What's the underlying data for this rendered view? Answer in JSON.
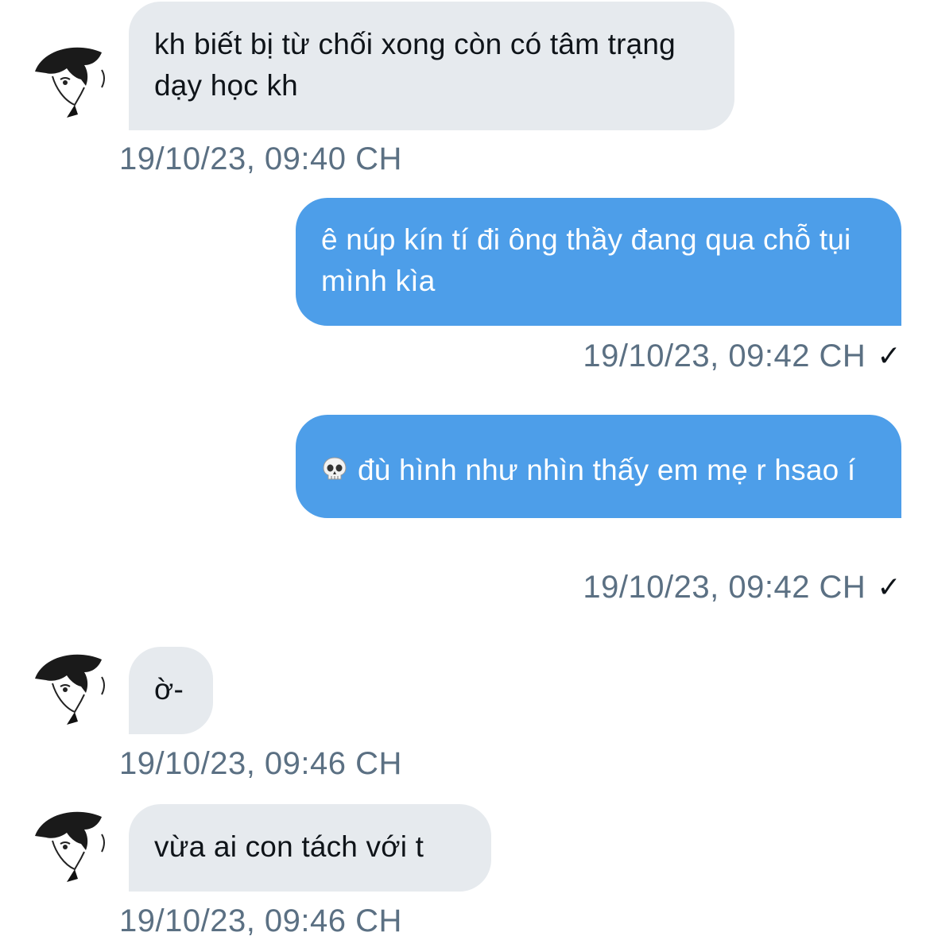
{
  "messages": [
    {
      "direction": "incoming",
      "text": "kh biết bị từ chối xong còn có tâm trạng dạy học kh",
      "timestamp": "19/10/23, 09:40 CH"
    },
    {
      "direction": "outgoing",
      "text": "ê núp kín tí đi ông thầy đang qua chỗ tụi mình kìa",
      "timestamp": "19/10/23, 09:42 CH",
      "status_icon": "check-icon",
      "status_glyph": "✓"
    },
    {
      "direction": "outgoing",
      "emoji_icon": "skull-emoji",
      "text": "đù hình như nhìn thấy em mẹ r hsao í",
      "timestamp": "19/10/23, 09:42 CH",
      "status_icon": "check-icon",
      "status_glyph": "✓"
    },
    {
      "direction": "incoming",
      "text": "ờ-",
      "timestamp": "19/10/23, 09:46 CH"
    },
    {
      "direction": "incoming",
      "text": "vừa ai con tách với t",
      "timestamp": "19/10/23, 09:46 CH"
    }
  ],
  "colors": {
    "incoming_bubble": "#e6eaee",
    "outgoing_bubble": "#4d9ee9",
    "timestamp_text": "#5b7083",
    "incoming_text": "#0f1419",
    "outgoing_text": "#ffffff"
  },
  "avatar_icon": "manga-avatar-icon"
}
